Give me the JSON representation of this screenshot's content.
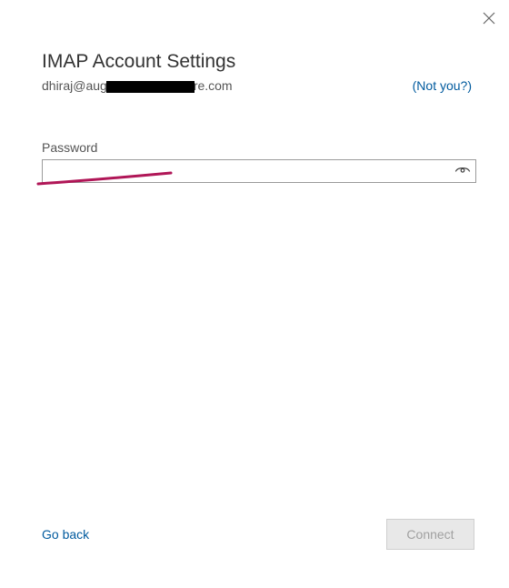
{
  "dialog": {
    "title": "IMAP Account Settings",
    "email_prefix": "dhiraj@aug",
    "email_suffix": "re.com",
    "not_you_label": "(Not you?)"
  },
  "password_section": {
    "label": "Password",
    "value": ""
  },
  "footer": {
    "go_back_label": "Go back",
    "connect_label": "Connect"
  },
  "icons": {
    "close": "close-icon",
    "reveal": "eye-icon"
  }
}
